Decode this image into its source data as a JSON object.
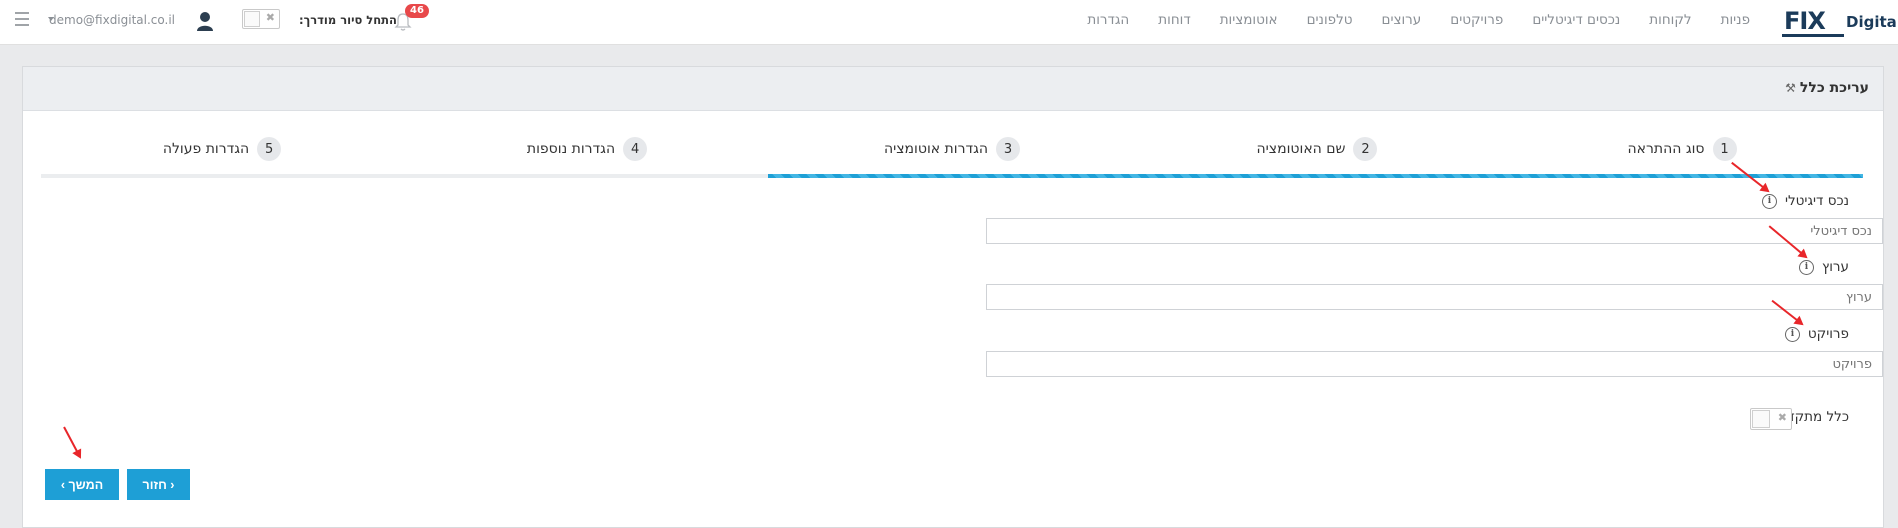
{
  "header": {
    "logo_text_fix": "FIX",
    "logo_text_digital": "Digital",
    "nav": [
      "פניות",
      "לקוחות",
      "נכסים דיגיטליים",
      "פרויקטים",
      "ערוצים",
      "טלפונים",
      "אוטומציות",
      "דוחות",
      "הגדרות"
    ],
    "notification_count": "46",
    "tour_label": "התחל סיור מודרך:",
    "user_email": "demo@fixdigital.co.il"
  },
  "panel": {
    "title": "עריכת כלל"
  },
  "steps": [
    {
      "num": "1",
      "label": "סוג ההתראה"
    },
    {
      "num": "2",
      "label": "שם האוטומציה"
    },
    {
      "num": "3",
      "label": "הגדרות אוטומציה"
    },
    {
      "num": "4",
      "label": "הגדרות נוספות"
    },
    {
      "num": "5",
      "label": "הגדרות פעולה"
    }
  ],
  "form": {
    "digital_asset": {
      "label": "נכס דיגיטלי",
      "placeholder": "נכס דיגיטלי"
    },
    "channel": {
      "label": "ערוץ",
      "placeholder": "ערוץ"
    },
    "project": {
      "label": "פרויקט",
      "placeholder": "פרויקט"
    },
    "advanced_rule_label": "כלל מתקדם"
  },
  "buttons": {
    "back_label": "‹ חזור",
    "next_label": "המשך ›"
  },
  "colors": {
    "accent": "#1e9fd6",
    "badge": "#e8484a",
    "annotation_arrow": "#e8262a"
  }
}
